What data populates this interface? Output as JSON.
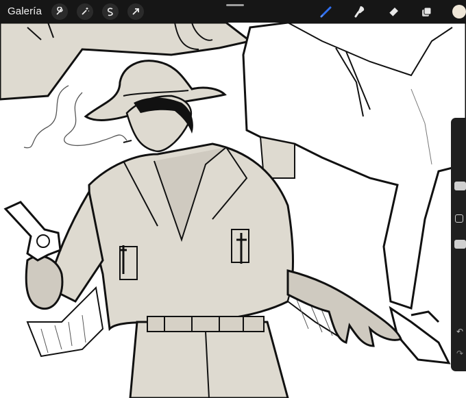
{
  "topbar": {
    "gallery_label": "Galería",
    "tools_left": [
      "wrench-icon",
      "magic-wand-icon",
      "selection-icon",
      "transform-arrow-icon"
    ],
    "tools_right": [
      "brush-icon",
      "smudge-icon",
      "eraser-icon",
      "layers-icon",
      "color-swatch"
    ]
  },
  "colors": {
    "topbar_bg": "#161616",
    "brush_active": "#2f6ff0",
    "current_color": "#efe7d8",
    "sketch_fill": "#dedad0",
    "line": "#111111"
  },
  "sidebar": {
    "controls": [
      "brush-size-slider",
      "modify-button",
      "opacity-slider",
      "undo-icon",
      "redo-icon"
    ]
  }
}
